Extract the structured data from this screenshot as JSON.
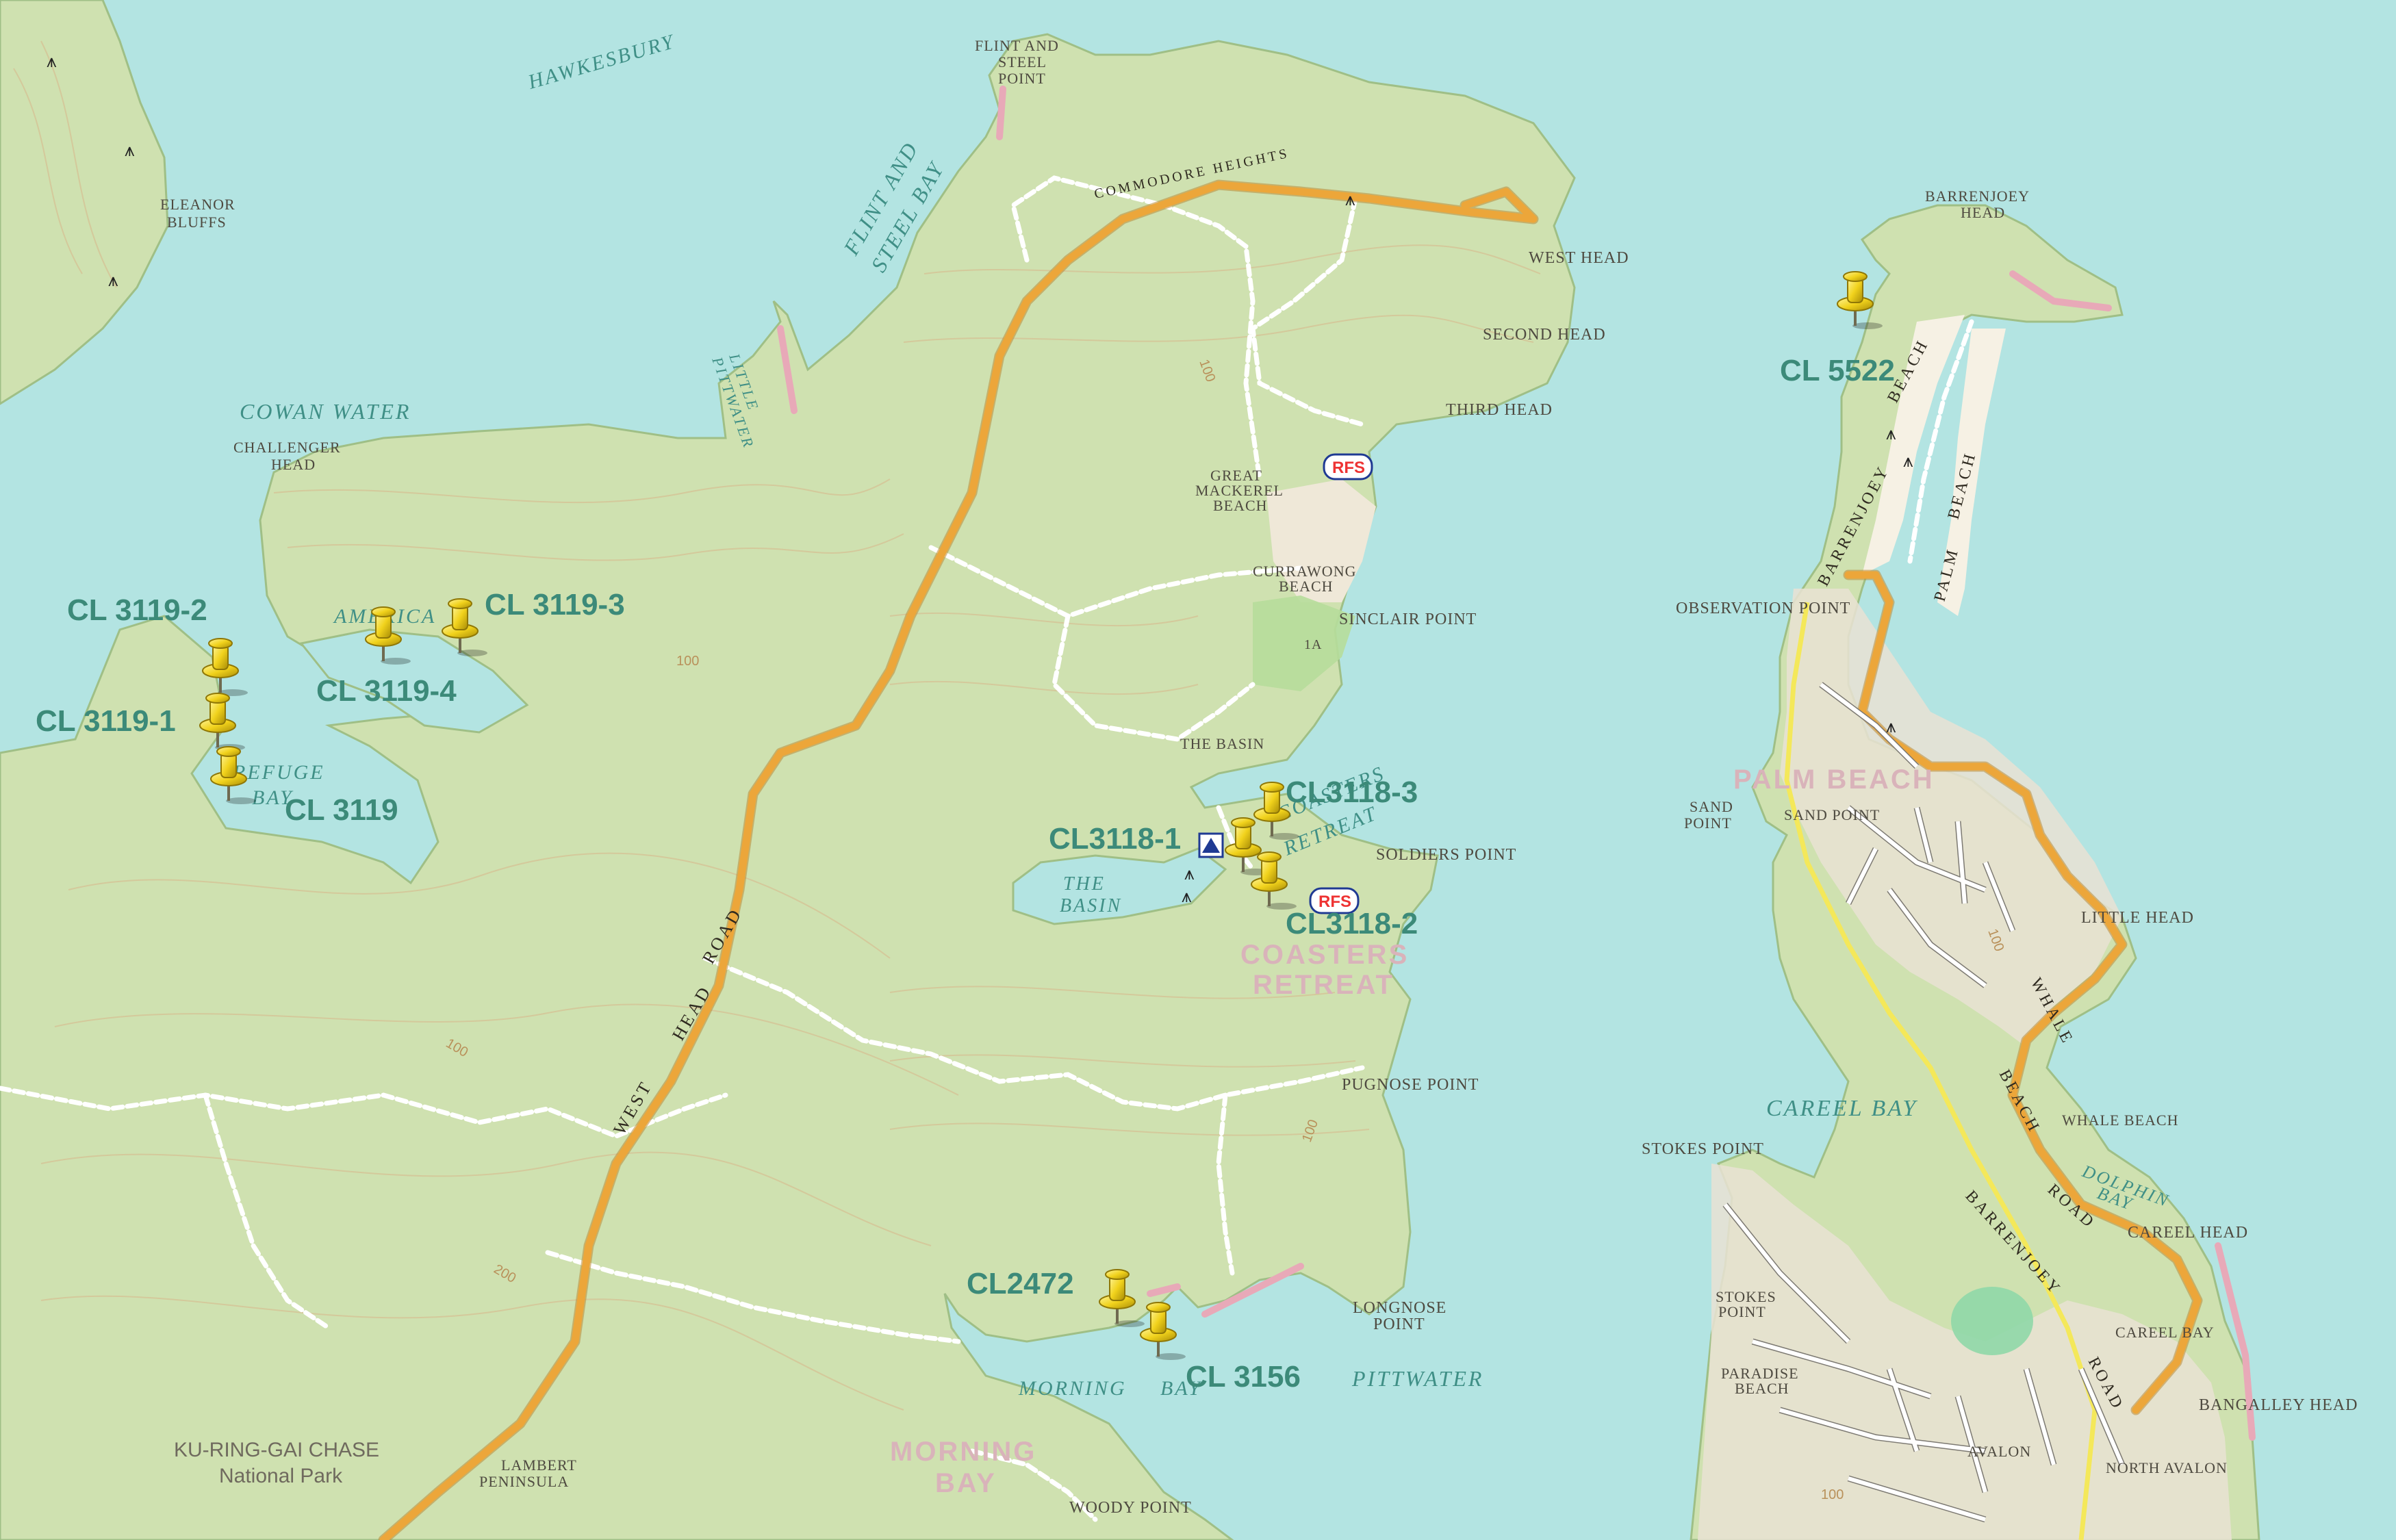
{
  "colors": {
    "water": "#b3e4e2",
    "land": "#cfe1b0",
    "land_dark": "#bcd59b",
    "urban": "#e9e2d4",
    "beach": "#f6f1e4",
    "sportsground": "#b6dd9b",
    "cliff": "#e8a9b8",
    "main_road": "#eca63a",
    "track": "#ffffff",
    "marker_label": "#3c8a79",
    "pin_head": "#f1d21c"
  },
  "icons": {
    "marker": "yellow-pushpin-icon",
    "boat_ramp": "boat-ramp-icon",
    "campground": "campground-icon",
    "rfs": "rfs-station-icon"
  },
  "water_labels": {
    "hawkesbury": "HAWKESBURY",
    "flint_steel_bay_1": "FLINT   AND",
    "flint_steel_bay_2": "STEEL   BAY",
    "little_pittwater_1": "LITTLE",
    "little_pittwater_2": "PITTWATER",
    "cowan_water": "COWAN    WATER",
    "america_bay": "AMERICA",
    "refuge_bay_1": "REFUGE",
    "refuge_bay_2": "BAY",
    "coasters_retreat_water_1": "COASTERS",
    "coasters_retreat_water_2": "RETREAT",
    "the_basin_water_1": "THE",
    "the_basin_water_2": "BASIN",
    "careel_bay": "CAREEL    BAY",
    "dolphin_bay_1": "DOLPHIN",
    "dolphin_bay_2": "BAY",
    "morning_bay_water_1": "MORNING",
    "morning_bay_water_2": "BAY",
    "pittwater": "PITTWATER"
  },
  "place_labels": {
    "eleanor_bluffs_1": "ELEANOR",
    "eleanor_bluffs_2": "BLUFFS",
    "flint_steel_point_1": "FLINT AND",
    "flint_steel_point_2": "STEEL",
    "flint_steel_point_3": "POINT",
    "west_head": "WEST HEAD",
    "second_head": "SECOND HEAD",
    "third_head": "THIRD HEAD",
    "challenger_head_1": "CHALLENGER",
    "challenger_head_2": "HEAD",
    "great_mackerel_beach_1": "GREAT",
    "great_mackerel_beach_2": "MACKEREL",
    "great_mackerel_beach_3": "BEACH",
    "currawong_beach_1": "CURRAWONG",
    "currawong_beach_2": "BEACH",
    "sinclair_point": "SINCLAIR POINT",
    "the_basin": "THE BASIN",
    "soldiers_point": "SOLDIERS POINT",
    "pugnose_point": "PUGNOSE POINT",
    "longnose_point_1": "LONGNOSE",
    "longnose_point_2": "POINT",
    "woody_point": "WOODY POINT",
    "lambert_peninsula_1": "LAMBERT",
    "lambert_peninsula_2": "PENINSULA",
    "barrenjoey_head_1": "BARRENJOEY",
    "barrenjoey_head_2": "HEAD",
    "observation_point": "OBSERVATION POINT",
    "sand_point_1": "SAND",
    "sand_point_2": "POINT",
    "sand_point_inner": "SAND POINT",
    "little_head": "LITTLE HEAD",
    "whale_beach": "WHALE BEACH",
    "stokes_point": "STOKES POINT",
    "careel_head": "CAREEL HEAD",
    "careel_bay_inner": "CAREEL BAY",
    "stokes_beach_1": "STOKES",
    "stokes_beach_2": "POINT",
    "paradise_beach_1": "PARADISE",
    "paradise_beach_2": "BEACH",
    "avalon": "AVALON",
    "north_avalon": "NORTH AVALON",
    "bangalley_head": "BANGALLEY HEAD",
    "sportsground": "1A"
  },
  "road_labels": {
    "commodore_heights": "COMMODORE  HEIGHTS",
    "west_head_road_1": "WEST",
    "west_head_road_2": "HEAD",
    "west_head_road_3": "ROAD",
    "barrenjoey_beach_1": "BARRENJOEY",
    "barrenjoey_beach_2": "BEACH",
    "palm_beach_vertical_1": "PALM",
    "palm_beach_vertical_2": "BEACH",
    "whale_beach_road_1": "WHALE",
    "whale_beach_road_2": "BEACH",
    "whale_beach_road_3": "ROAD",
    "barrenjoey_road": "BARRENJOEY",
    "barrenjoey_road_2": "ROAD",
    "barrenjoey_road_3": "BARRENJOEY"
  },
  "suburb_labels": {
    "palm_beach": "PALM BEACH",
    "coasters_retreat_1": "COASTERS",
    "coasters_retreat_2": "RETREAT",
    "morning_bay_1": "MORNING",
    "morning_bay_2": "BAY"
  },
  "contour_labels": [
    "100",
    "100",
    "100",
    "100",
    "200",
    "100",
    "100"
  ],
  "park_label": {
    "line1": "KU-RING-GAI CHASE",
    "line2": "National Park"
  },
  "rfs_labels": [
    "RFS",
    "RFS"
  ],
  "markers": [
    {
      "id": "CL 3119-2",
      "label": "CL 3119-2"
    },
    {
      "id": "CL 3119-1",
      "label": "CL 3119-1"
    },
    {
      "id": "CL 3119",
      "label": "CL 3119"
    },
    {
      "id": "CL 3119-4",
      "label": "CL 3119-4"
    },
    {
      "id": "CL 3119-3",
      "label": "CL 3119-3"
    },
    {
      "id": "CL3118-1",
      "label": "CL3118-1"
    },
    {
      "id": "CL3118-3",
      "label": "CL3118-3"
    },
    {
      "id": "CL3118-2",
      "label": "CL3118-2"
    },
    {
      "id": "CL2472",
      "label": "CL2472"
    },
    {
      "id": "CL 3156",
      "label": "CL 3156"
    },
    {
      "id": "CL 5522",
      "label": "CL 5522"
    }
  ]
}
